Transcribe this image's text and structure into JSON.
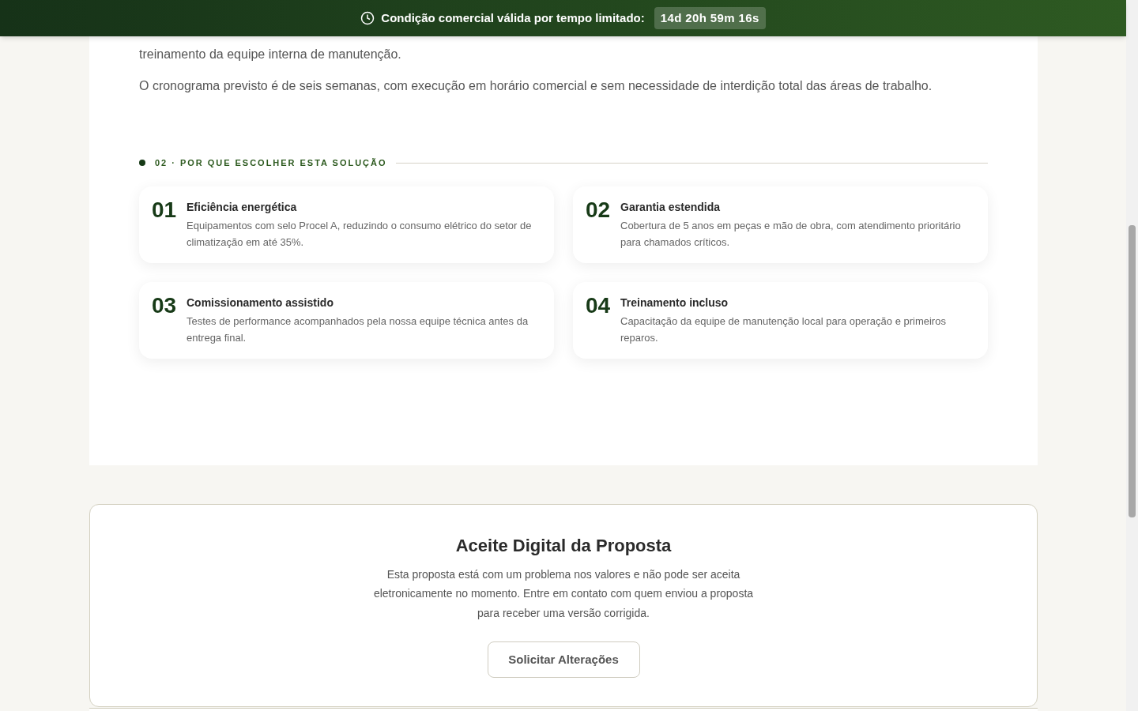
{
  "banner": {
    "label": "Condição comercial válida por tempo limitado:",
    "countdown": "14d 20h 59m 16s"
  },
  "intro": {
    "paragraphs": [
      "treinamento da equipe interna de manutenção.",
      "O cronograma previsto é de seis semanas, com execução em horário comercial e sem necessidade de interdição total das áreas de trabalho."
    ]
  },
  "benefits": {
    "heading": "02 · POR QUE ESCOLHER ESTA SOLUÇÃO",
    "items": [
      {
        "number": "01",
        "title": "Eficiência energética",
        "text": "Equipamentos com selo Procel A, reduzindo o consumo elétrico do setor de climatização em até 35%."
      },
      {
        "number": "02",
        "title": "Garantia estendida",
        "text": "Cobertura de 5 anos em peças e mão de obra, com atendimento prioritário para chamados críticos."
      },
      {
        "number": "03",
        "title": "Comissionamento assistido",
        "text": "Testes de performance acompanhados pela nossa equipe técnica antes da entrega final."
      },
      {
        "number": "04",
        "title": "Treinamento incluso",
        "text": "Capacitação da equipe de manutenção local para operação e primeiros reparos."
      }
    ]
  },
  "acceptance": {
    "title": "Aceite Digital da Proposta",
    "text": "Esta proposta está com um problema nos valores e não pode ser aceita eletronicamente no momento. Entre em contato com quem enviou a proposta para receber uma versão corrigida.",
    "button": "Solicitar Alterações"
  }
}
